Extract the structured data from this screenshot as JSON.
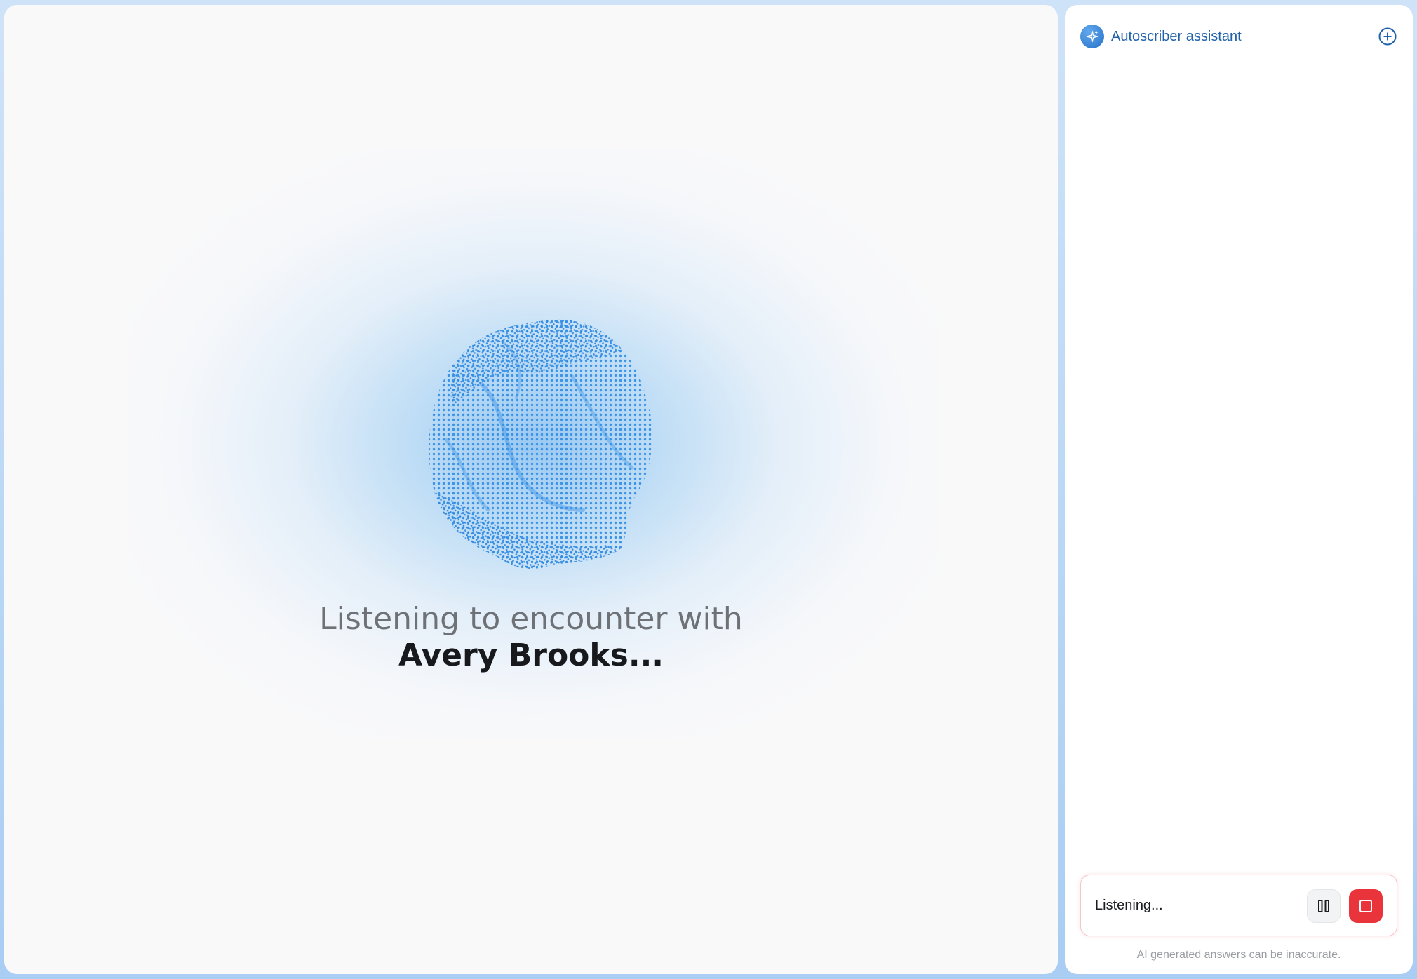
{
  "main": {
    "status_line1": "Listening to encounter with",
    "patient_name": "Avery Brooks...",
    "accent_color": "#3a93e6"
  },
  "assistant": {
    "title": "Autoscriber assistant",
    "logo_icon": "sparkle-icon",
    "new_chat_icon": "plus-circle-icon",
    "status_text": "Listening...",
    "pause_icon": "pause-icon",
    "stop_icon": "stop-icon",
    "disclaimer": "AI generated answers can be inaccurate.",
    "stop_color": "#e8343a",
    "title_color": "#1f62a9"
  }
}
